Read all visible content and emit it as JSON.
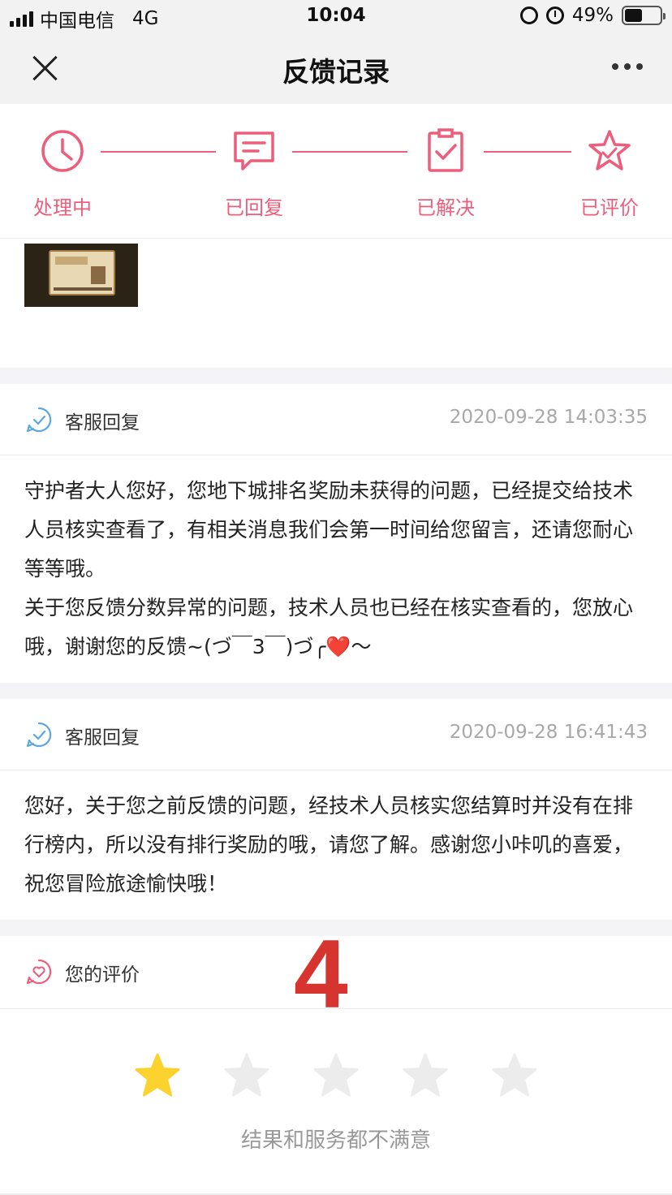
{
  "status_bar": {
    "carrier": "中国电信",
    "network": "4G",
    "time": "10:04",
    "battery": "49%"
  },
  "nav": {
    "title": "反馈记录"
  },
  "progress": {
    "steps": [
      {
        "label": "处理中",
        "icon": "clock-icon"
      },
      {
        "label": "已回复",
        "icon": "chat-icon"
      },
      {
        "label": "已解决",
        "icon": "clipboard-check-icon"
      },
      {
        "label": "已评价",
        "icon": "star-icon"
      }
    ],
    "color": "#ec5e7c"
  },
  "replies": [
    {
      "label": "客服回复",
      "time": "2020-09-28 14:03:35",
      "paragraphs": [
        "守护者大人您好，您地下城排名奖励未获得的问题，已经提交给技术人员核实查看了，有相关消息我们会第一时间给您留言，还请您耐心等等哦。",
        "关于您反馈分数异常的问题，技术人员也已经在核实查看的，您放心哦，谢谢您的反馈~(づ￣3￣)づ╭❤️～"
      ]
    },
    {
      "label": "客服回复",
      "time": "2020-09-28 16:41:43",
      "paragraphs": [
        "您好，关于您之前反馈的问题，经技术人员核实您结算时并没有在排行榜内，所以没有排行奖励的哦，请您了解。感谢您小咔叽的喜爱，祝您冒险旅途愉快哦！"
      ]
    }
  ],
  "rating": {
    "label": "您的评价",
    "stars_selected": 1,
    "stars_total": 5,
    "result_text": "结果和服务都不满意",
    "annotation": "4",
    "star_color_on": "#fbd22e",
    "star_color_off": "#ececec"
  }
}
